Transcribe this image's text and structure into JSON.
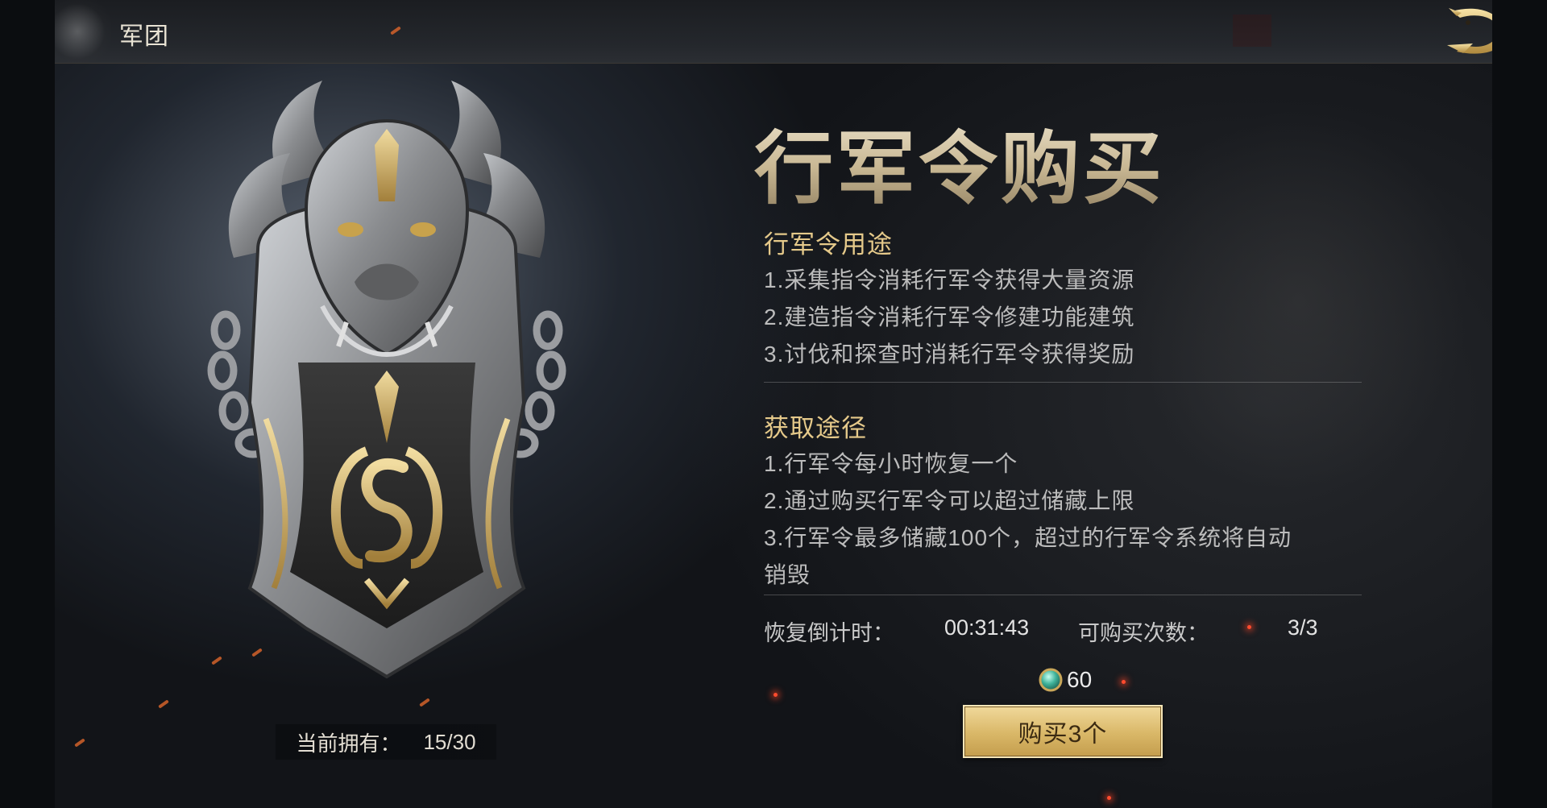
{
  "topbar": {
    "title": "军团",
    "close_icon": "dragon-close-icon"
  },
  "hero": {
    "art_icon": "marching-token-shield-icon",
    "inventory_label": "当前拥有：",
    "inventory_value": "15/30"
  },
  "content": {
    "headline": "行军令购买",
    "usage": {
      "title": "行军令用途",
      "items": [
        "1.采集指令消耗行军令获得大量资源",
        "2.建造指令消耗行军令修建功能建筑",
        "3.讨伐和探查时消耗行军令获得奖励"
      ]
    },
    "acquire": {
      "title": "获取途径",
      "items": [
        "1.行军令每小时恢复一个",
        "2.通过购买行军令可以超过储藏上限",
        "3.行军令最多储藏100个，超过的行军令系统将自动",
        "销毁"
      ]
    },
    "stats": {
      "countdown_label": "恢复倒计时：",
      "countdown_value": "00:31:43",
      "purchases_label": "可购买次数：",
      "purchases_value": "3/3"
    },
    "cost": {
      "icon": "jade-currency-icon",
      "value": "60"
    },
    "buy_button": "购买3个"
  },
  "colors": {
    "accent_gold": "#e5c98a",
    "button_gold": "#d9b767",
    "text_light": "#bcbcbc"
  }
}
